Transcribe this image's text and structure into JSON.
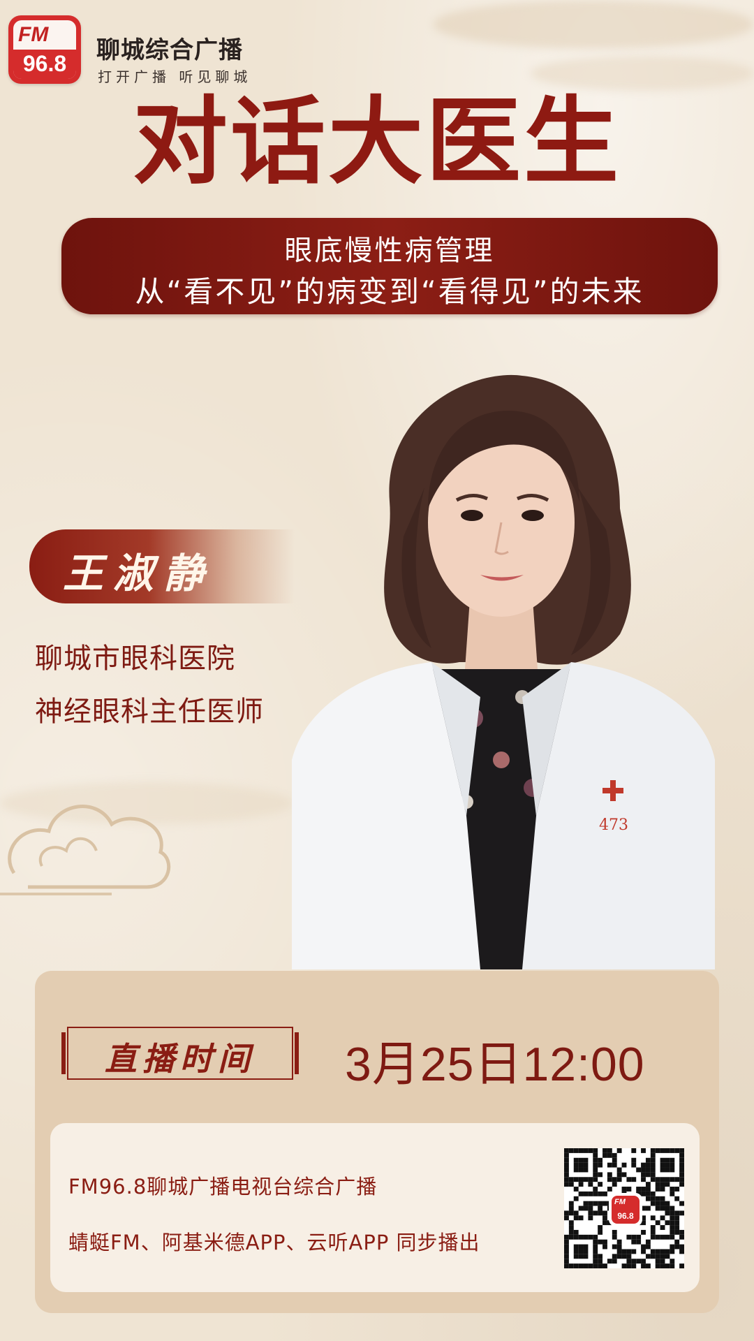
{
  "colors": {
    "background": "#efe4d3",
    "accent_red": "#8e1a12",
    "banner_dark_red": "#6e130d",
    "logo_red": "#d52c2c",
    "info_card": "#e3cdb2",
    "channel_card": "#f7efe5"
  },
  "header": {
    "logo_fm": "FM",
    "logo_frequency": "96.8",
    "station_name": "聊城综合广播",
    "station_slogan": "打开广播 听见聊城"
  },
  "title": "对话大医生",
  "subtitle": {
    "line1": "眼底慢性病管理",
    "line2": "从“看不见”的病变到“看得见”的未来"
  },
  "doctor": {
    "name": "王淑静",
    "organization": "聊城市眼科医院",
    "position": "神经眼科主任医师",
    "coat_badge_number": "473"
  },
  "broadcast": {
    "time_label": "直播时间",
    "time_value": "3月25日12:00",
    "channel_line1": "FM96.8聊城广播电视台综合广播",
    "channel_line2": "蜻蜓FM、阿基米德APP、云听APP 同步播出",
    "qr_logo_fm": "FM",
    "qr_logo_frequency": "96.8"
  },
  "icons": {
    "logo": "fm968-logo-icon",
    "cloud": "auspicious-cloud-icon",
    "qr": "qr-code-icon"
  }
}
